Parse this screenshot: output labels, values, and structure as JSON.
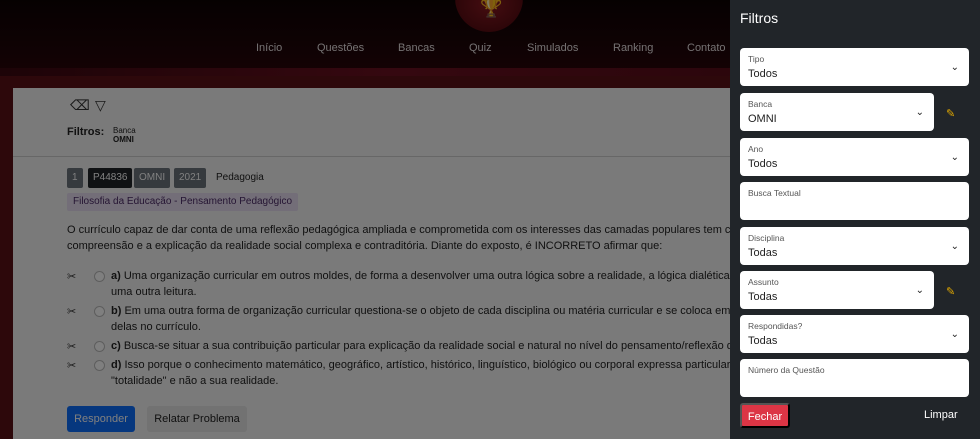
{
  "header": {
    "nav": [
      "Início",
      "Questões",
      "Bancas",
      "Quiz",
      "Simulados",
      "Ranking",
      "Contato"
    ],
    "logo_icon": "trophy-icon"
  },
  "toolbar": {
    "eraser_icon": "eraser-icon",
    "filter_icon": "funnel-icon",
    "filters_label": "Filtros:",
    "filter_tag_label": "Banca",
    "filter_tag_value": "OMNI"
  },
  "question": {
    "number": "1",
    "id": "P44836",
    "banca": "OMNI",
    "ano": "2021",
    "subject": "Pedagogia",
    "topic": "Filosofia da Educação - Pensamento Pedagógico",
    "statement_line1": "O currículo capaz de dar conta de uma reflexão pedagógica ampliada e comprometida com os interesses das camadas populares tem como",
    "statement_line2": "compreensão e a explicação da realidade social complexa e contraditória. Diante do exposto, é INCORRETO afirmar que:",
    "options": [
      {
        "letter": "a)",
        "line1": "Uma organização curricular em outros moldes, de forma a desenvolver uma outra lógica sobre a realidade, a lógica dialética, com a",
        "line2": "uma outra leitura."
      },
      {
        "letter": "b)",
        "line1": "Em uma outra forma de organização curricular questiona-se o objeto de cada disciplina ou matéria curricular e se coloca em destaq",
        "line2": "delas no currículo."
      },
      {
        "letter": "c)",
        "line1": "Busca-se situar a sua contribuição particular para explicação da realidade social e natural no nível do pensamento/reflexão do aluno",
        "line2": ""
      },
      {
        "letter": "d)",
        "line1": "Isso porque o conhecimento matemático, geográfico, artístico, histórico, linguístico, biológico ou corporal expressa particularmente",
        "line2": "\"totalidade\" e não a sua realidade."
      }
    ],
    "submit_label": "Responder",
    "report_label": "Relatar Problema"
  },
  "panel": {
    "title": "Filtros",
    "fields": [
      {
        "label": "Tipo",
        "value": "Todos"
      },
      {
        "label": "Banca",
        "value": "OMNI"
      },
      {
        "label": "Ano",
        "value": "Todos"
      },
      {
        "label": "Busca Textual",
        "value": ""
      },
      {
        "label": "Disciplina",
        "value": "Todas"
      },
      {
        "label": "Assunto",
        "value": "Todas"
      },
      {
        "label": "Respondidas?",
        "value": "Todas"
      },
      {
        "label": "Número da Questão",
        "value": ""
      }
    ],
    "close_label": "Fechar",
    "clear_label": "Limpar"
  },
  "colors": {
    "accent_red": "#dc3545",
    "primary_blue": "#0d6efd",
    "panel_bg": "#212529",
    "pen_icon": "#e0a800"
  }
}
